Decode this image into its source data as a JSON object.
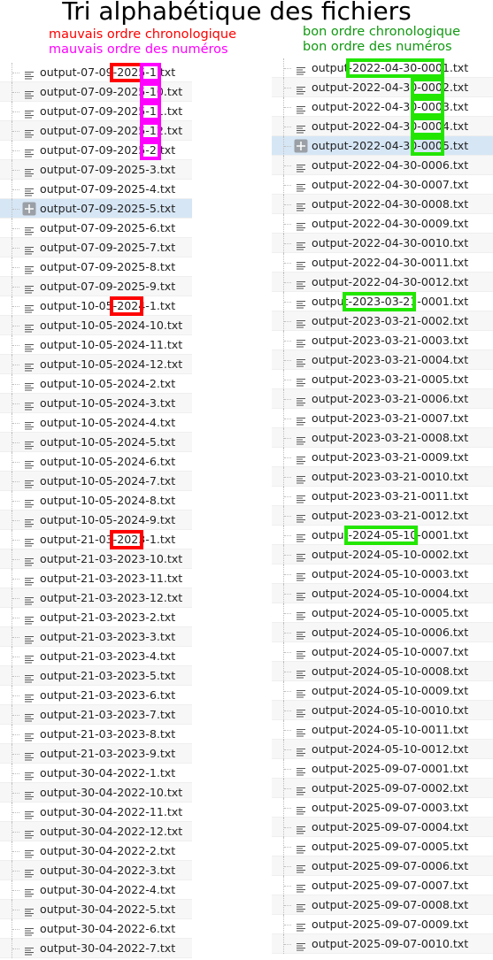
{
  "title": "Tri alphabétique des fichiers",
  "left_caption": {
    "line1": "mauvais ordre chronologique",
    "line2": "mauvais ordre des numéros"
  },
  "right_caption": {
    "line1": "bon ordre chronologique",
    "line2": "bon ordre des numéros"
  },
  "colors": {
    "red": "#ff0000",
    "magenta": "#ff00ff",
    "green": "#22e600",
    "selection": "#d6e6f5"
  },
  "icons": {
    "file": "text-file-icon",
    "selected": "expand-plus-icon"
  },
  "left_files": [
    "output-07-09-2025-1.txt",
    "output-07-09-2025-10.txt",
    "output-07-09-2025-11.txt",
    "output-07-09-2025-12.txt",
    "output-07-09-2025-2.txt",
    "output-07-09-2025-3.txt",
    "output-07-09-2025-4.txt",
    "output-07-09-2025-5.txt",
    "output-07-09-2025-6.txt",
    "output-07-09-2025-7.txt",
    "output-07-09-2025-8.txt",
    "output-07-09-2025-9.txt",
    "output-10-05-2024-1.txt",
    "output-10-05-2024-10.txt",
    "output-10-05-2024-11.txt",
    "output-10-05-2024-12.txt",
    "output-10-05-2024-2.txt",
    "output-10-05-2024-3.txt",
    "output-10-05-2024-4.txt",
    "output-10-05-2024-5.txt",
    "output-10-05-2024-6.txt",
    "output-10-05-2024-7.txt",
    "output-10-05-2024-8.txt",
    "output-10-05-2024-9.txt",
    "output-21-03-2023-1.txt",
    "output-21-03-2023-10.txt",
    "output-21-03-2023-11.txt",
    "output-21-03-2023-12.txt",
    "output-21-03-2023-2.txt",
    "output-21-03-2023-3.txt",
    "output-21-03-2023-4.txt",
    "output-21-03-2023-5.txt",
    "output-21-03-2023-6.txt",
    "output-21-03-2023-7.txt",
    "output-21-03-2023-8.txt",
    "output-21-03-2023-9.txt",
    "output-30-04-2022-1.txt",
    "output-30-04-2022-10.txt",
    "output-30-04-2022-11.txt",
    "output-30-04-2022-12.txt",
    "output-30-04-2022-2.txt",
    "output-30-04-2022-3.txt",
    "output-30-04-2022-4.txt",
    "output-30-04-2022-5.txt",
    "output-30-04-2022-6.txt",
    "output-30-04-2022-7.txt"
  ],
  "left_selected": "output-07-09-2025-5.txt",
  "right_files": [
    "output-2022-04-30-0001.txt",
    "output-2022-04-30-0002.txt",
    "output-2022-04-30-0003.txt",
    "output-2022-04-30-0004.txt",
    "output-2022-04-30-0005.txt",
    "output-2022-04-30-0006.txt",
    "output-2022-04-30-0007.txt",
    "output-2022-04-30-0008.txt",
    "output-2022-04-30-0009.txt",
    "output-2022-04-30-0010.txt",
    "output-2022-04-30-0011.txt",
    "output-2022-04-30-0012.txt",
    "output-2023-03-21-0001.txt",
    "output-2023-03-21-0002.txt",
    "output-2023-03-21-0003.txt",
    "output-2023-03-21-0004.txt",
    "output-2023-03-21-0005.txt",
    "output-2023-03-21-0006.txt",
    "output-2023-03-21-0007.txt",
    "output-2023-03-21-0008.txt",
    "output-2023-03-21-0009.txt",
    "output-2023-03-21-0010.txt",
    "output-2023-03-21-0011.txt",
    "output-2023-03-21-0012.txt",
    "output-2024-05-10-0001.txt",
    "output-2024-05-10-0002.txt",
    "output-2024-05-10-0003.txt",
    "output-2024-05-10-0004.txt",
    "output-2024-05-10-0005.txt",
    "output-2024-05-10-0006.txt",
    "output-2024-05-10-0007.txt",
    "output-2024-05-10-0008.txt",
    "output-2024-05-10-0009.txt",
    "output-2024-05-10-0010.txt",
    "output-2024-05-10-0011.txt",
    "output-2024-05-10-0012.txt",
    "output-2025-09-07-0001.txt",
    "output-2025-09-07-0002.txt",
    "output-2025-09-07-0003.txt",
    "output-2025-09-07-0004.txt",
    "output-2025-09-07-0005.txt",
    "output-2025-09-07-0006.txt",
    "output-2025-09-07-0007.txt",
    "output-2025-09-07-0008.txt",
    "output-2025-09-07-0009.txt",
    "output-2025-09-07-0010.txt"
  ],
  "right_selected": "output-2022-04-30-0005.txt"
}
